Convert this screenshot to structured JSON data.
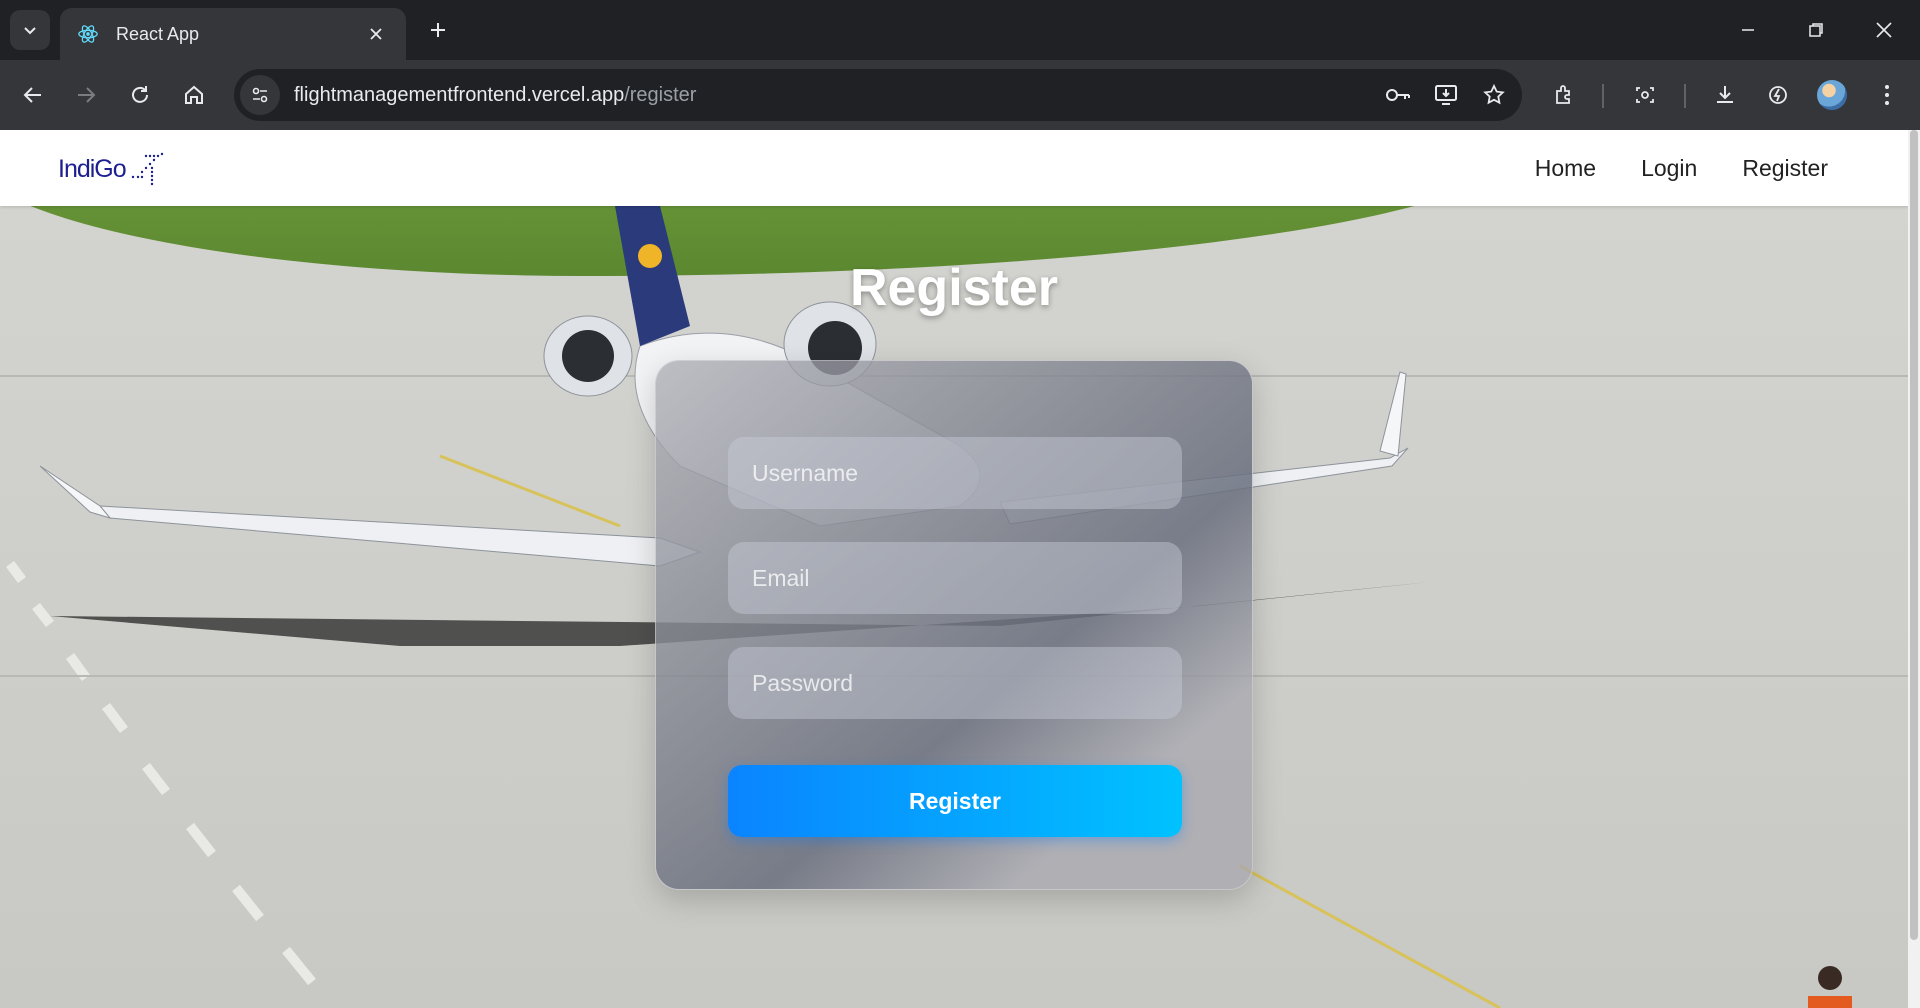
{
  "browser": {
    "tab_title": "React App",
    "url_host": "flightmanagementfrontend.vercel.app",
    "url_path": "/register"
  },
  "navbar": {
    "logo_text": "IndiGo",
    "links": [
      "Home",
      "Login",
      "Register"
    ]
  },
  "form": {
    "title": "Register",
    "username_placeholder": "Username",
    "email_placeholder": "Email",
    "password_placeholder": "Password",
    "submit_label": "Register"
  },
  "colors": {
    "accent_start": "#0a84ff",
    "accent_end": "#00c2ff",
    "logo_blue": "#1d1f8f"
  },
  "icons": [
    "chevron-down-icon",
    "react-icon",
    "close-icon",
    "plus-icon",
    "minimize-icon",
    "restore-icon",
    "back-icon",
    "forward-icon",
    "reload-icon",
    "home-icon",
    "site-settings-icon",
    "key-icon",
    "install-icon",
    "star-icon",
    "extensions-icon",
    "screenshot-icon",
    "download-icon",
    "performance-icon",
    "menu-icon"
  ]
}
